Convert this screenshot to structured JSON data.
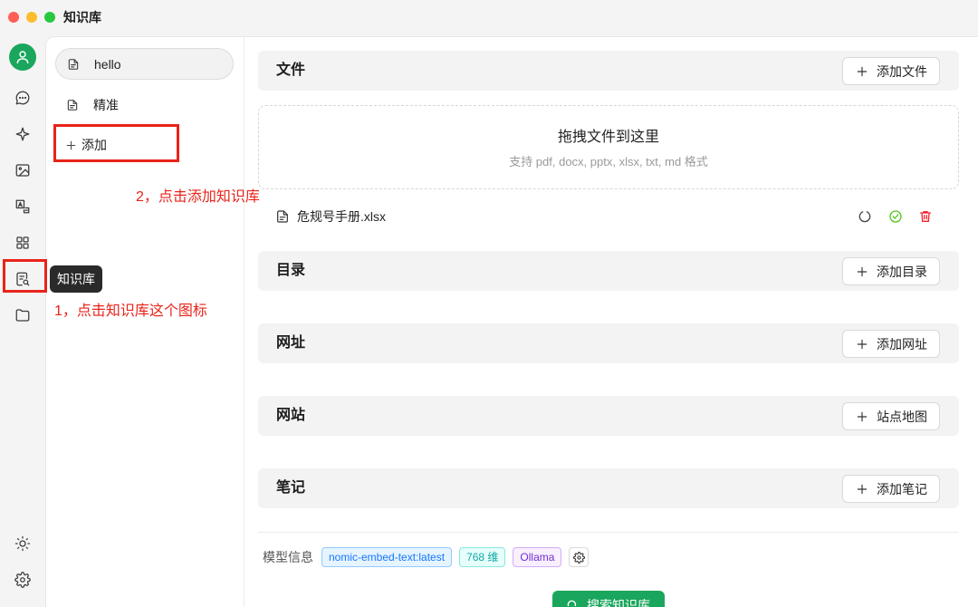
{
  "window": {
    "title": "知识库",
    "traffic_lights": [
      "#ff5f57",
      "#febc2e",
      "#28c840"
    ]
  },
  "sidebar": {
    "top_icons": [
      "user-avatar-icon",
      "chat-icon",
      "sparkle-icon",
      "image-icon",
      "translate-icon",
      "apps-grid-icon",
      "knowledge-base-icon",
      "folder-icon"
    ],
    "bottom_icons": [
      "sun-icon",
      "settings-icon"
    ],
    "active": "knowledge-base-icon",
    "avatar_color": "#1aa65c"
  },
  "tooltip": {
    "text": "知识库"
  },
  "annotations": {
    "step1": "1，点击知识库这个图标",
    "step2": "2，点击添加知识库",
    "color": "#e8231a"
  },
  "kb_list": {
    "items": [
      {
        "label": "hello",
        "icon": "document-icon",
        "selected": true
      },
      {
        "label": "精准",
        "icon": "document-icon",
        "selected": false
      }
    ],
    "add_label": "添加"
  },
  "main": {
    "files": {
      "title": "文件",
      "button": "添加文件"
    },
    "dropzone": {
      "title": "拖拽文件到这里",
      "hint": "支持 pdf, docx, pptx, xlsx, txt, md 格式"
    },
    "file_items": [
      {
        "name": "危规号手册.xlsx",
        "actions": [
          "refresh-icon",
          "check-circle-icon",
          "trash-icon"
        ]
      }
    ],
    "directories": {
      "title": "目录",
      "button": "添加目录"
    },
    "urls": {
      "title": "网址",
      "button": "添加网址"
    },
    "websites": {
      "title": "网站",
      "button": "站点地图"
    },
    "notes": {
      "title": "笔记",
      "button": "添加笔记"
    }
  },
  "model_info": {
    "label": "模型信息",
    "model": "nomic-embed-text:latest",
    "dimensions": "768 维",
    "provider": "Ollama"
  },
  "search_button": {
    "label": "搜索知识库",
    "color": "#1aa65c"
  },
  "status_colors": {
    "success": "#52c41a",
    "danger": "#f5222d"
  }
}
